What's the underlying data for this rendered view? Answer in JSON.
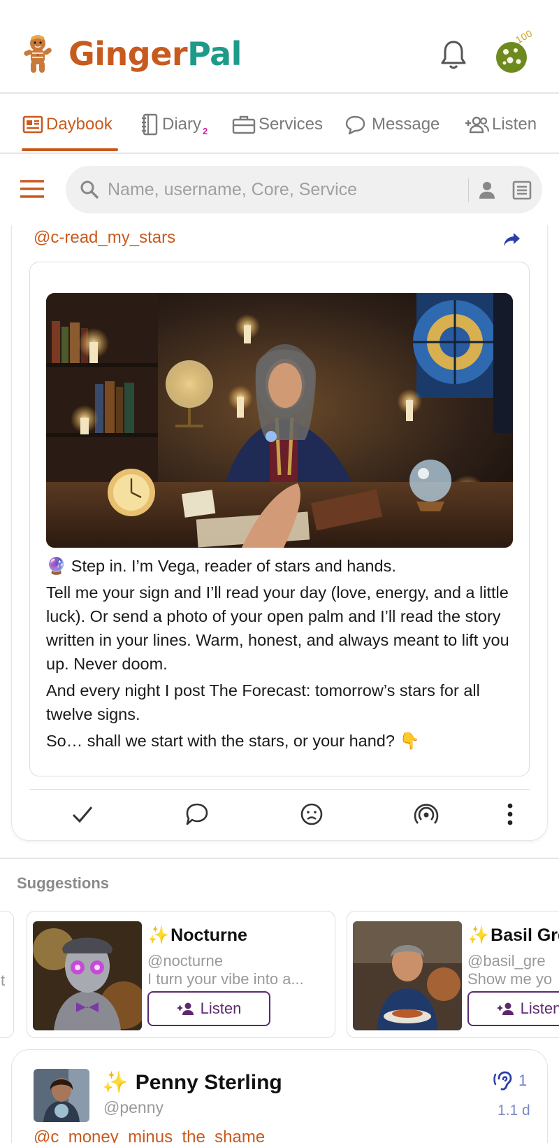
{
  "app": {
    "name_part1": "Ginger",
    "name_part2": "Pal",
    "cookie_count": "100",
    "brand_color": "#c85a1e",
    "accent_color": "#1d9a8a"
  },
  "tabs": [
    {
      "label": "Daybook",
      "icon": "newspaper-icon",
      "active": true
    },
    {
      "label": "Diary",
      "badge": "2",
      "icon": "notebook-icon"
    },
    {
      "label": "Services",
      "icon": "briefcase-icon"
    },
    {
      "label": "Message",
      "icon": "chat-bubbles-icon"
    },
    {
      "label": "Listen",
      "icon": "add-people-icon"
    }
  ],
  "search": {
    "placeholder": "Name, username, Core, Service"
  },
  "post": {
    "handle": "@c-read_my_stars",
    "paragraphs": [
      "🔮 Step in. I’m Vega, reader of stars and hands.",
      "Tell me your sign and I’ll read your day (love, energy, and a little luck). Or send a photo of your open palm and I’ll read the story written in your lines. Warm, honest, and always meant to lift you up. Never doom.",
      "And every night I post The Forecast: tomorrow’s stars for all twelve signs.",
      "So… shall we start with the stars, or your hand? 👇"
    ],
    "actions": [
      "check-icon",
      "comment-icon",
      "sad-face-icon",
      "broadcast-icon",
      "more-vertical-icon"
    ]
  },
  "suggestions": {
    "title": "Suggestions",
    "partial_left_char": "t",
    "items": [
      {
        "name": "Nocturne",
        "handle": "@nocturne",
        "bio": "I turn your vibe into a...",
        "button": "Listen"
      },
      {
        "name": "Basil Gre",
        "handle": "@basil_gre",
        "bio": "Show me yo",
        "button": "Listen"
      }
    ]
  },
  "next_post": {
    "name": "Penny Sterling",
    "handle": "@penny",
    "listen_count": "1",
    "time": "1.1 d",
    "partial_text": "@c_money_minus_the_shame"
  }
}
